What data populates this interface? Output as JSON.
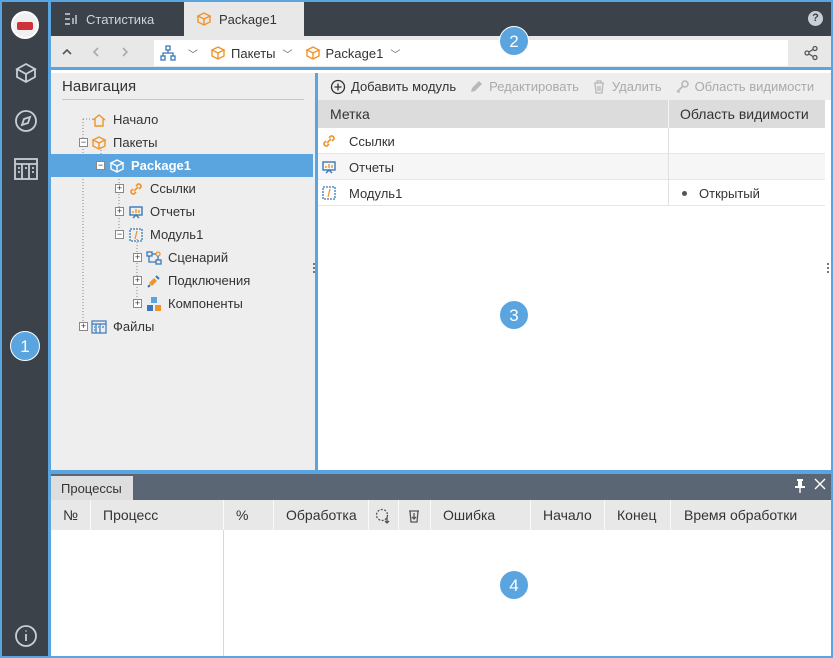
{
  "tabs": [
    {
      "label": "Статистика",
      "icon": "statistics-icon",
      "active": false
    },
    {
      "label": "Package1",
      "icon": "package-icon",
      "active": true
    }
  ],
  "help_label": "?",
  "breadcrumbs": [
    {
      "label": "",
      "icon": "hierarchy-icon"
    },
    {
      "label": "Пакеты",
      "icon": "package-icon"
    },
    {
      "label": "Package1",
      "icon": "package-icon"
    }
  ],
  "navigation": {
    "title": "Навигация",
    "items": [
      {
        "label": "Начало",
        "icon": "home-icon",
        "level": 0,
        "expander": "none"
      },
      {
        "label": "Пакеты",
        "icon": "package-icon",
        "level": 0,
        "expander": "minus"
      },
      {
        "label": "Package1",
        "icon": "package-icon",
        "level": 1,
        "expander": "minus",
        "selected": true
      },
      {
        "label": "Ссылки",
        "icon": "link-icon",
        "level": 2,
        "expander": "plus"
      },
      {
        "label": "Отчеты",
        "icon": "report-icon",
        "level": 2,
        "expander": "plus"
      },
      {
        "label": "Модуль1",
        "icon": "module-icon",
        "level": 2,
        "expander": "minus"
      },
      {
        "label": "Сценарий",
        "icon": "scenario-icon",
        "level": 3,
        "expander": "plus"
      },
      {
        "label": "Подключения",
        "icon": "connection-icon",
        "level": 3,
        "expander": "plus"
      },
      {
        "label": "Компоненты",
        "icon": "components-icon",
        "level": 3,
        "expander": "plus"
      },
      {
        "label": "Файлы",
        "icon": "files-icon",
        "level": 0,
        "expander": "plus"
      }
    ]
  },
  "toolbar": {
    "add_module": "Добавить модуль",
    "edit": "Редактировать",
    "delete": "Удалить",
    "visibility": "Область видимости"
  },
  "table": {
    "columns": [
      "Метка",
      "Область видимости"
    ],
    "rows": [
      {
        "label": "Ссылки",
        "icon": "link-icon",
        "visibility": ""
      },
      {
        "label": "Отчеты",
        "icon": "report-icon",
        "visibility": ""
      },
      {
        "label": "Модуль1",
        "icon": "module-icon",
        "visibility": "Открытый"
      }
    ]
  },
  "processes": {
    "tab_label": "Процессы",
    "columns": [
      "№",
      "Процесс",
      "%",
      "Обработка",
      "",
      "",
      "Ошибка",
      "Начало",
      "Конец",
      "Время обработки"
    ]
  },
  "badges": [
    "1",
    "2",
    "3",
    "4"
  ],
  "colors": {
    "accent": "#5aa5df",
    "dark_bar": "#3c4249",
    "panel_bg": "#eeeeee",
    "icon_orange": "#f0932b"
  }
}
